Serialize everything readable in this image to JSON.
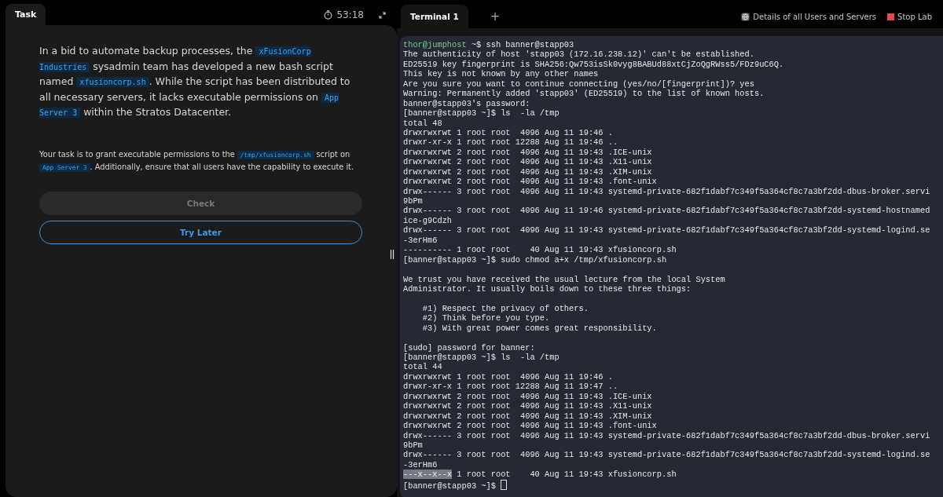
{
  "task_panel": {
    "tab": {
      "label": "Task",
      "selected": true
    },
    "timer": "53:18",
    "paragraphs": [
      [
        {
          "text": "In a bid to automate backup processes, the "
        },
        {
          "code": "xFusionCorp Industries"
        },
        {
          "text": " sysadmin team has developed a new bash script named "
        },
        {
          "code": "xfusioncorp.sh"
        },
        {
          "text": ". While the script has been distributed to all necessary servers, it lacks executable permissions on "
        },
        {
          "code": "App Server 3"
        },
        {
          "text": " within the Stratos Datacenter."
        }
      ],
      [
        {
          "text": "Your task is to grant executable permissions to the "
        },
        {
          "code": "/tmp/xfusioncorp.sh"
        },
        {
          "text": " script on "
        },
        {
          "code": "App Server 3"
        },
        {
          "text": ". Additionally, ensure that all users have the capability to execute it."
        }
      ]
    ],
    "buttons": [
      {
        "label": "Check",
        "kind": "filled",
        "disabled": true
      },
      {
        "label": "Try Later",
        "kind": "outline",
        "disabled": false
      }
    ]
  },
  "terminal_panel": {
    "tabs": [
      {
        "label": "Terminal 1",
        "selected": true
      }
    ],
    "add_tab": "+",
    "links": [
      {
        "label": "Details of all Users and Servers",
        "kind": "globe"
      },
      {
        "label": "Stop Lab",
        "kind": "stop"
      }
    ],
    "lines": [
      {
        "kind": "prompt",
        "user": "thor@jumphost",
        "text": " ~$ ssh banner@stapp03"
      },
      {
        "kind": "text",
        "text": "The authenticity of host 'stapp03 (172.16.238.12)' can't be established."
      },
      {
        "kind": "text",
        "text": "ED25519 key fingerprint is SHA256:Qw753isSk0vyg8BABUd88xtCjZoQgRWss5/FDz9uC6Q."
      },
      {
        "kind": "text",
        "text": "This key is not known by any other names"
      },
      {
        "kind": "text",
        "text": "Are you sure you want to continue connecting (yes/no/[fingerprint])? yes"
      },
      {
        "kind": "text",
        "text": "Warning: Permanently added 'stapp03' (ED25519) to the list of known hosts."
      },
      {
        "kind": "text",
        "text": "banner@stapp03's password:"
      },
      {
        "kind": "text",
        "text": "[banner@stapp03 ~]$ ls  -la /tmp"
      },
      {
        "kind": "text",
        "text": "total 48"
      },
      {
        "kind": "text",
        "text": "drwxrwxrwt 1 root root  4096 Aug 11 19:46 ."
      },
      {
        "kind": "text",
        "text": "drwxr-xr-x 1 root root 12288 Aug 11 19:46 .."
      },
      {
        "kind": "text",
        "text": "drwxrwxrwt 2 root root  4096 Aug 11 19:43 .ICE-unix"
      },
      {
        "kind": "text",
        "text": "drwxrwxrwt 2 root root  4096 Aug 11 19:43 .X11-unix"
      },
      {
        "kind": "text",
        "text": "drwxrwxrwt 2 root root  4096 Aug 11 19:43 .XIM-unix"
      },
      {
        "kind": "text",
        "text": "drwxrwxrwt 2 root root  4096 Aug 11 19:43 .font-unix"
      },
      {
        "kind": "text",
        "text": "drwx------ 3 root root  4096 Aug 11 19:43 systemd-private-682f1dabf7c349f5a364cf8c7a3bf2dd-dbus-broker.servi"
      },
      {
        "kind": "text",
        "text": "9bPm"
      },
      {
        "kind": "text",
        "text": "drwx------ 3 root root  4096 Aug 11 19:46 systemd-private-682f1dabf7c349f5a364cf8c7a3bf2dd-systemd-hostnamed"
      },
      {
        "kind": "text",
        "text": "ice-g9Cdzh"
      },
      {
        "kind": "text",
        "text": "drwx------ 3 root root  4096 Aug 11 19:43 systemd-private-682f1dabf7c349f5a364cf8c7a3bf2dd-systemd-logind.se"
      },
      {
        "kind": "text",
        "text": "-3erHm6"
      },
      {
        "kind": "text",
        "text": "---------- 1 root root    40 Aug 11 19:43 xfusioncorp.sh"
      },
      {
        "kind": "text",
        "text": "[banner@stapp03 ~]$ sudo chmod a+x /tmp/xfusioncorp.sh"
      },
      {
        "kind": "blank"
      },
      {
        "kind": "text",
        "text": "We trust you have received the usual lecture from the local System"
      },
      {
        "kind": "text",
        "text": "Administrator. It usually boils down to these three things:"
      },
      {
        "kind": "blank"
      },
      {
        "kind": "text",
        "text": "    #1) Respect the privacy of others."
      },
      {
        "kind": "text",
        "text": "    #2) Think before you type."
      },
      {
        "kind": "text",
        "text": "    #3) With great power comes great responsibility."
      },
      {
        "kind": "blank"
      },
      {
        "kind": "text",
        "text": "[sudo] password for banner:"
      },
      {
        "kind": "text",
        "text": "[banner@stapp03 ~]$ ls  -la /tmp"
      },
      {
        "kind": "text",
        "text": "total 44"
      },
      {
        "kind": "text",
        "text": "drwxrwxrwt 1 root root  4096 Aug 11 19:46 ."
      },
      {
        "kind": "text",
        "text": "drwxr-xr-x 1 root root 12288 Aug 11 19:47 .."
      },
      {
        "kind": "text",
        "text": "drwxrwxrwt 2 root root  4096 Aug 11 19:43 .ICE-unix"
      },
      {
        "kind": "text",
        "text": "drwxrwxrwt 2 root root  4096 Aug 11 19:43 .X11-unix"
      },
      {
        "kind": "text",
        "text": "drwxrwxrwt 2 root root  4096 Aug 11 19:43 .XIM-unix"
      },
      {
        "kind": "text",
        "text": "drwxrwxrwt 2 root root  4096 Aug 11 19:43 .font-unix"
      },
      {
        "kind": "text",
        "text": "drwx------ 3 root root  4096 Aug 11 19:43 systemd-private-682f1dabf7c349f5a364cf8c7a3bf2dd-dbus-broker.servi"
      },
      {
        "kind": "text",
        "text": "9bPm"
      },
      {
        "kind": "text",
        "text": "drwx------ 3 root root  4096 Aug 11 19:43 systemd-private-682f1dabf7c349f5a364cf8c7a3bf2dd-systemd-logind.se"
      },
      {
        "kind": "text",
        "text": "-3erHm6"
      },
      {
        "kind": "selection",
        "selected_text": "---x--x--x",
        "text": " 1 root root    40 Aug 11 19:43 xfusioncorp.sh"
      },
      {
        "kind": "cursor",
        "text": "[banner@stapp03 ~]$ "
      }
    ]
  }
}
